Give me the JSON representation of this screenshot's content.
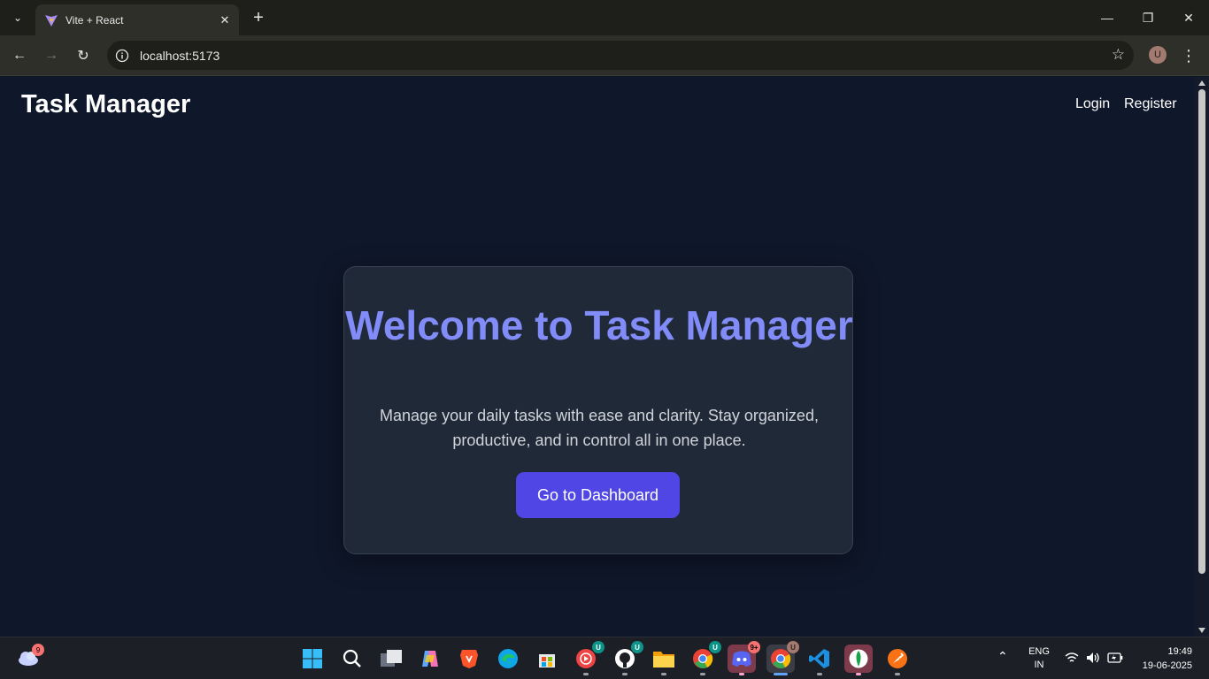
{
  "browser": {
    "tab_title": "Vite + React",
    "url": "localhost:5173",
    "profile_initial": "U"
  },
  "page": {
    "brand": "Task Manager",
    "nav": {
      "login": "Login",
      "register": "Register"
    },
    "hero": {
      "title": "Welcome to Task Manager",
      "description": "Manage your daily tasks with ease and clarity. Stay organized, productive, and in control all in one place.",
      "cta": "Go to Dashboard"
    }
  },
  "colors": {
    "page_bg": "#0f172a",
    "card_bg": "#1f2937",
    "accent_title": "#818cf8",
    "cta_bg": "#4f46e5"
  },
  "taskbar": {
    "weather_badge": "9",
    "apps": [
      {
        "name": "start-icon"
      },
      {
        "name": "search-icon"
      },
      {
        "name": "task-view-icon"
      },
      {
        "name": "copilot-icon"
      },
      {
        "name": "brave-icon"
      },
      {
        "name": "edge-icon"
      },
      {
        "name": "store-icon"
      },
      {
        "name": "youtube-music-icon",
        "badge": "U"
      },
      {
        "name": "github-icon",
        "badge": "U"
      },
      {
        "name": "file-explorer-icon"
      },
      {
        "name": "chrome-icon",
        "badge": "U"
      },
      {
        "name": "discord-icon",
        "badge": "9+"
      },
      {
        "name": "chrome-profile-icon",
        "badge": "U"
      },
      {
        "name": "vscode-icon"
      },
      {
        "name": "mongodb-compass-icon"
      },
      {
        "name": "postman-icon"
      }
    ],
    "language": "ENG",
    "region": "IN",
    "time": "19:49",
    "date": "19-06-2025"
  }
}
